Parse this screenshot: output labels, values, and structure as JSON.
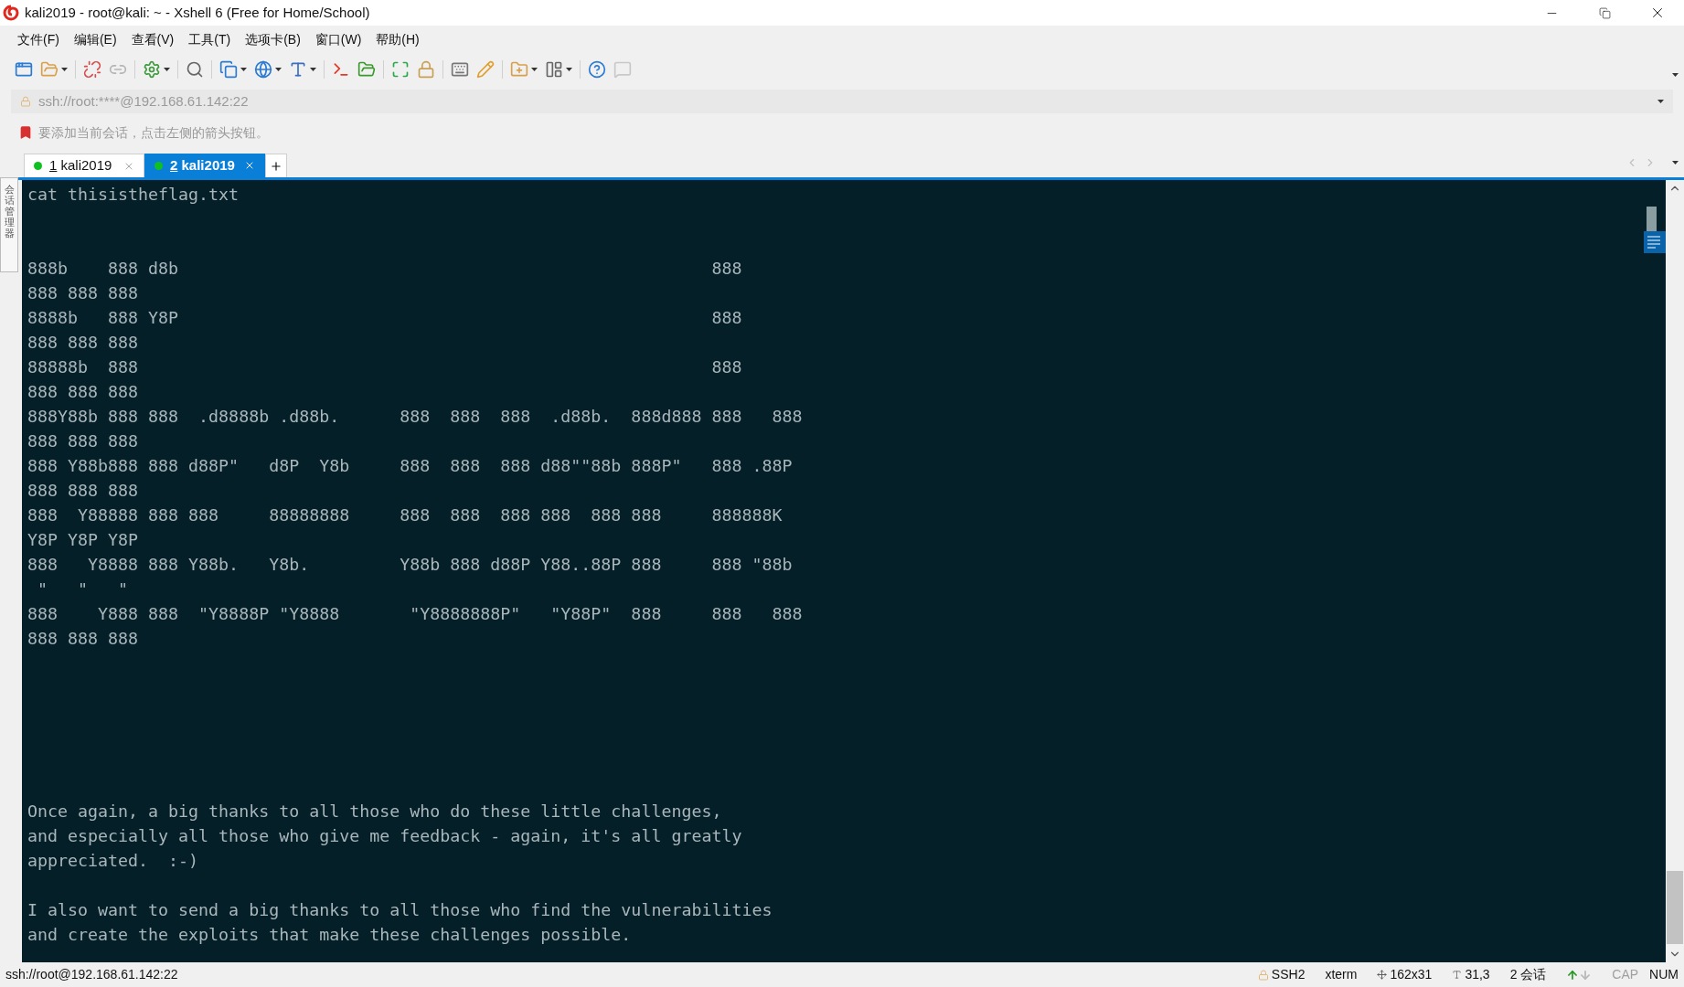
{
  "window": {
    "title": "kali2019 - root@kali: ~ - Xshell 6 (Free for Home/School)"
  },
  "menu": [
    "文件(F)",
    "编辑(E)",
    "查看(V)",
    "工具(T)",
    "选项卡(B)",
    "窗口(W)",
    "帮助(H)"
  ],
  "address_bar": {
    "value": "ssh://root:****@192.168.61.142:22"
  },
  "hint_bar": {
    "text": "要添加当前会话，点击左侧的箭头按钮。"
  },
  "side_panel": {
    "label": "会话管理器"
  },
  "tabs": [
    {
      "number": "1",
      "label": "kali2019",
      "selected": false
    },
    {
      "number": "2",
      "label": "kali2019",
      "selected": true
    }
  ],
  "terminal": {
    "blocks": [
      [
        "cat thisistheflag.txt"
      ],
      [
        "888b    888 d8b                                                     888",
        "888 888 888",
        "8888b   888 Y8P                                                     888",
        "888 888 888",
        "88888b  888                                                         888",
        "888 888 888",
        "888Y88b 888 888  .d8888b .d88b.      888  888  888  .d88b.  888d888 888   888",
        "888 888 888",
        "888 Y88b888 888 d88P\"   d8P  Y8b     888  888  888 d88\"\"88b 888P\"   888 .88P",
        "888 888 888",
        "888  Y88888 888 888     88888888     888  888  888 888  888 888     888888K",
        "Y8P Y8P Y8P",
        "888   Y8888 888 Y88b.   Y8b.         Y88b 888 d88P Y88..88P 888     888 \"88b",
        " \"   \"   \"",
        "888    Y888 888  \"Y8888P \"Y8888       \"Y8888888P\"   \"Y88P\"  888     888   888",
        "888 888 888"
      ],
      [
        "Once again, a big thanks to all those who do these little challenges,",
        "and especially all those who give me feedback - again, it's all greatly",
        "appreciated.  :-)"
      ],
      [
        "I also want to send a big thanks to all those who find the vulnerabilities",
        "and create the exploits that make these challenges possible."
      ]
    ]
  },
  "status_bar": {
    "connection": "ssh://root@192.168.61.142:22",
    "protocol": "SSH2",
    "terminal_type": "xterm",
    "size": "162x31",
    "cursor": "31,3",
    "sessions": "2 会话",
    "keys": [
      {
        "label": "CAP",
        "on": false
      },
      {
        "label": "NUM",
        "on": true
      }
    ]
  }
}
